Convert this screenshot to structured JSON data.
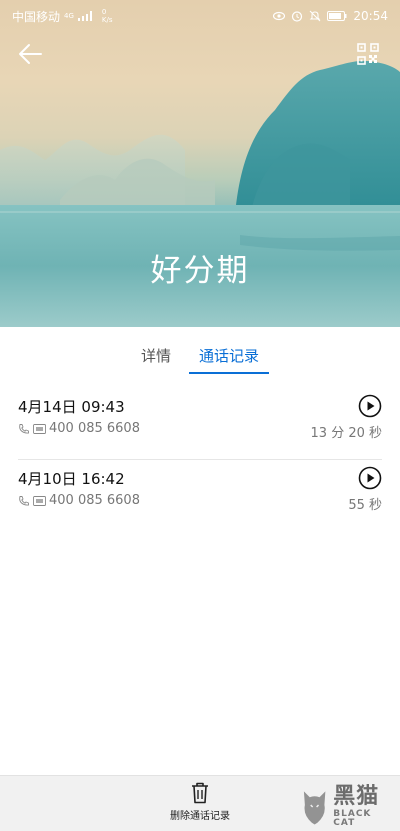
{
  "status_bar": {
    "carrier": "中国移动",
    "signal_tag": "4G",
    "net_speed_value": "0",
    "net_speed_unit": "K/s",
    "time": "20:54"
  },
  "contact": {
    "name": "好分期"
  },
  "tabs": [
    {
      "label": "详情"
    },
    {
      "label": "通话记录"
    }
  ],
  "calls": [
    {
      "date_time": "4月14日 09:43",
      "number": "400 085 6608",
      "duration": "13 分 20 秒"
    },
    {
      "date_time": "4月10日 16:42",
      "number": "400 085 6608",
      "duration": "55 秒"
    }
  ],
  "bottom_bar": {
    "delete_label": "删除通话记录"
  },
  "watermark": {
    "cn": "黑猫",
    "en": "BLACK CAT"
  },
  "colors": {
    "accent": "#0a6fd6"
  }
}
